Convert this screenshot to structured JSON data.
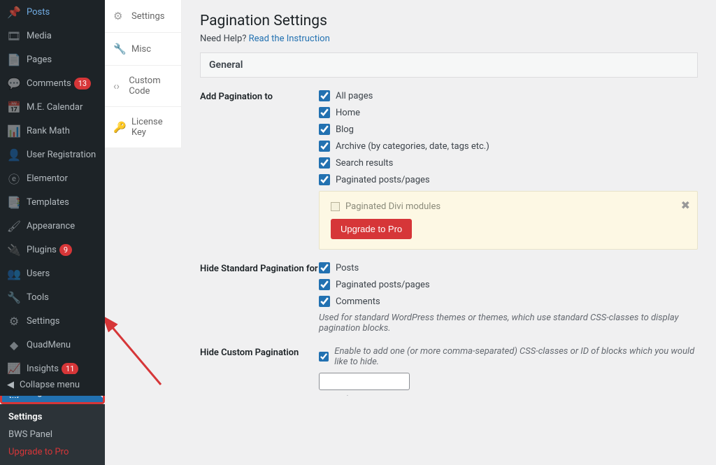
{
  "sidebar": {
    "items": [
      {
        "icon": "📌",
        "label": "Posts"
      },
      {
        "icon": "🎞",
        "label": "Media"
      },
      {
        "icon": "📄",
        "label": "Pages"
      },
      {
        "icon": "💬",
        "label": "Comments",
        "badge": "13"
      },
      {
        "icon": "📅",
        "label": "M.E. Calendar"
      },
      {
        "icon": "📊",
        "label": "Rank Math"
      },
      {
        "icon": "👤",
        "label": "User Registration"
      },
      {
        "icon": "ⓔ",
        "label": "Elementor"
      },
      {
        "icon": "📑",
        "label": "Templates"
      },
      {
        "icon": "🖌",
        "label": "Appearance"
      },
      {
        "icon": "🔌",
        "label": "Plugins",
        "badge": "9"
      },
      {
        "icon": "👥",
        "label": "Users"
      },
      {
        "icon": "🔧",
        "label": "Tools"
      },
      {
        "icon": "⚙",
        "label": "Settings"
      },
      {
        "icon": "◆",
        "label": "QuadMenu"
      },
      {
        "icon": "📈",
        "label": "Insights",
        "badge": "11"
      },
      {
        "icon": "⬚",
        "label": "Pagination"
      }
    ],
    "sub": [
      {
        "label": "Settings",
        "current": true
      },
      {
        "label": "BWS Panel"
      },
      {
        "label": "Upgrade to Pro",
        "orange": true
      }
    ],
    "collapse": "Collapse menu"
  },
  "tabs": [
    {
      "icon": "⚙",
      "label": "Settings"
    },
    {
      "icon": "🔧",
      "label": "Misc"
    },
    {
      "icon": "‹›",
      "label": "Custom Code"
    },
    {
      "icon": "🔑",
      "label": "License Key"
    }
  ],
  "page": {
    "title": "Pagination Settings",
    "help_prefix": "Need Help? ",
    "help_link": "Read the Instruction",
    "section": "General",
    "row1_label": "Add Pagination to",
    "add_opts": [
      "All pages",
      "Home",
      "Blog",
      "Archive (by categories, date, tags etc.)",
      "Search results",
      "Paginated posts/pages"
    ],
    "pro_disabled": "Paginated Divi modules",
    "pro_btn": "Upgrade to Pro",
    "row2_label": "Hide Standard Pagination for",
    "hide_opts": [
      "Posts",
      "Paginated posts/pages",
      "Comments"
    ],
    "hide_note": "Used for standard WordPress themes or themes, which use standard CSS-classes to display pagination blocks.",
    "row3_label": "Hide Custom Pagination",
    "hide_custom_chk": "Enable to add one (or more comma-separated) CSS-classes or ID of blocks which you would like to hide.",
    "example_label": "Example:",
    "example_code": "#nav_bLock"
  }
}
